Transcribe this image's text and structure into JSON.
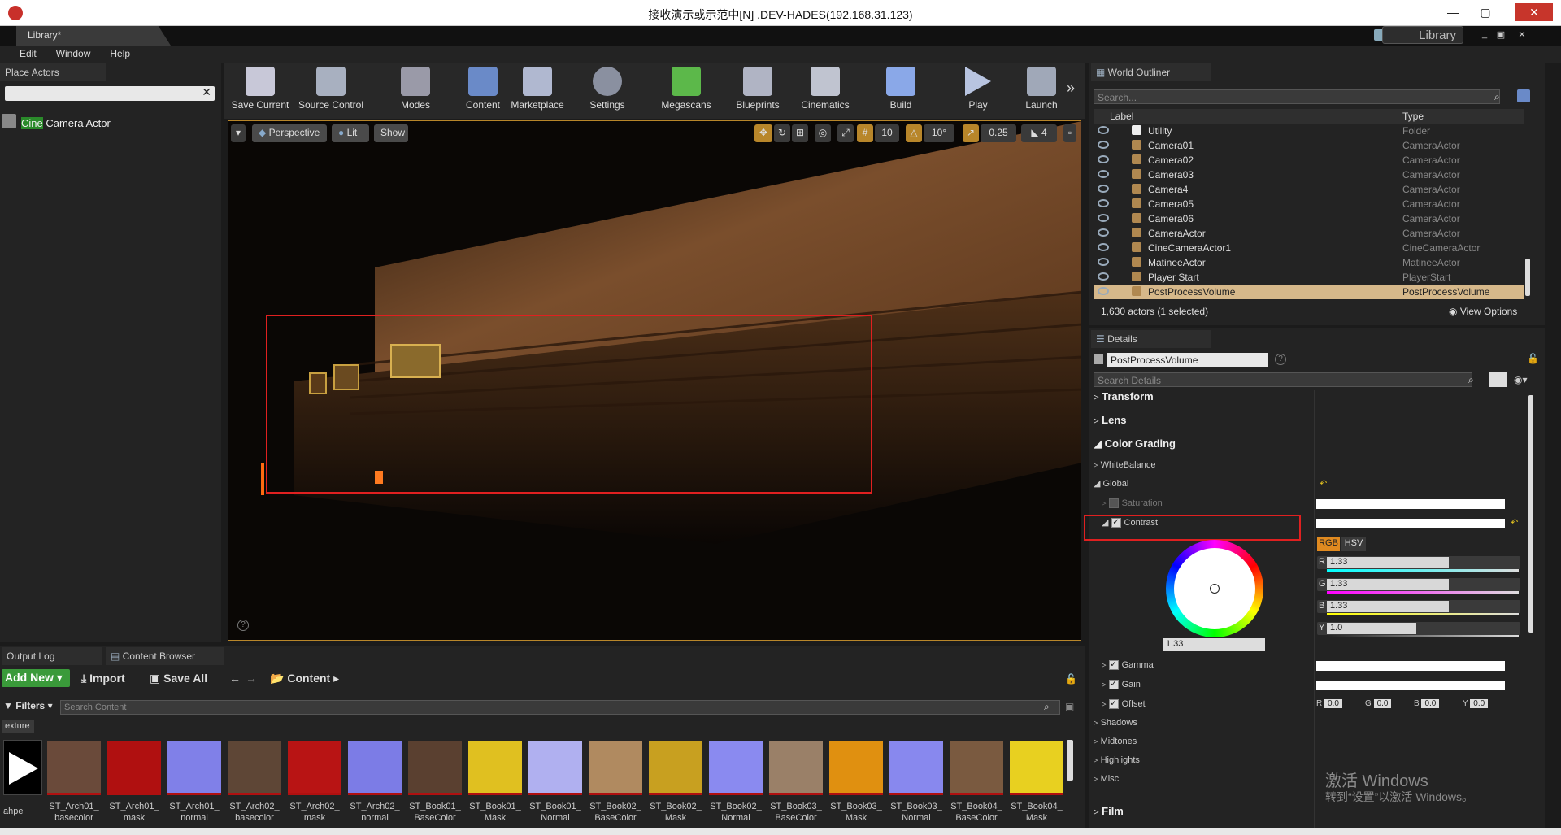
{
  "window": {
    "title": "接收演示或示范中[N] .DEV-HADES(192.168.31.123)"
  },
  "doc_tab": "Library*",
  "library_tag": "Library",
  "menu": [
    "Edit",
    "Window",
    "Help"
  ],
  "place_actors": {
    "tab": "Place Actors",
    "item_highlight": "Cine",
    "item_rest": " Camera Actor"
  },
  "toolbar": [
    {
      "label": "Save Current",
      "icon": "save-icon"
    },
    {
      "label": "Source Control",
      "icon": "source-control-icon"
    },
    {
      "label": "Modes",
      "icon": "modes-icon"
    },
    {
      "label": "Content",
      "icon": "content-icon"
    },
    {
      "label": "Marketplace",
      "icon": "marketplace-icon"
    },
    {
      "label": "Settings",
      "icon": "settings-icon"
    },
    {
      "label": "Megascans",
      "icon": "megascans-icon"
    },
    {
      "label": "Blueprints",
      "icon": "blueprints-icon"
    },
    {
      "label": "Cinematics",
      "icon": "cinematics-icon"
    },
    {
      "label": "Build",
      "icon": "build-icon"
    },
    {
      "label": "Play",
      "icon": "play-icon"
    },
    {
      "label": "Launch",
      "icon": "launch-icon"
    }
  ],
  "viewport": {
    "perspective": "Perspective",
    "lit": "Lit",
    "show": "Show",
    "grid_snap": "10",
    "rot_snap": "10°",
    "scale_snap": "0.25",
    "cam_speed": "4"
  },
  "outliner": {
    "tab": "World Outliner",
    "search_placeholder": "Search...",
    "col_label": "Label",
    "col_type": "Type",
    "rows": [
      {
        "label": "Utility",
        "type": "Folder"
      },
      {
        "label": "Camera01",
        "type": "CameraActor"
      },
      {
        "label": "Camera02",
        "type": "CameraActor"
      },
      {
        "label": "Camera03",
        "type": "CameraActor"
      },
      {
        "label": "Camera4",
        "type": "CameraActor"
      },
      {
        "label": "Camera05",
        "type": "CameraActor"
      },
      {
        "label": "Camera06",
        "type": "CameraActor"
      },
      {
        "label": "CameraActor",
        "type": "CameraActor"
      },
      {
        "label": "CineCameraActor1",
        "type": "CineCameraActor"
      },
      {
        "label": "MatineeActor",
        "type": "MatineeActor"
      },
      {
        "label": "Player Start",
        "type": "PlayerStart"
      },
      {
        "label": "PostProcessVolume",
        "type": "PostProcessVolume"
      }
    ],
    "status": "1,630 actors (1 selected)",
    "view_options": "View Options"
  },
  "details": {
    "tab": "Details",
    "object_name": "PostProcessVolume",
    "search_placeholder": "Search Details",
    "transform": "Transform",
    "lens": "Lens",
    "color_grading": "Color Grading",
    "white_balance": "WhiteBalance",
    "global": "Global",
    "saturation": "Saturation",
    "contrast": "Contrast",
    "rgb": "RGB",
    "hsv": "HSV",
    "r_val": "1.33",
    "g_val": "1.33",
    "b_val": "1.33",
    "y_val": "1.0",
    "wheel_val": "1.33",
    "gamma": "Gamma",
    "gain": "Gain",
    "offset": "Offset",
    "offset_r": "0.0",
    "offset_g": "0.0",
    "offset_b": "0.0",
    "offset_y": "0.0",
    "shadows": "Shadows",
    "midtones": "Midtones",
    "highlights": "Highlights",
    "misc": "Misc",
    "film": "Film"
  },
  "bottom": {
    "output_log": "Output Log",
    "content_browser": "Content Browser",
    "add_new": "Add New",
    "import": "Import",
    "save_all": "Save All",
    "content": "Content",
    "filters": "Filters",
    "search_placeholder": "Search Content",
    "filter_chip": "exture",
    "first_caption": "ahpe",
    "assets": [
      {
        "l1": "ST_Arch01_",
        "l2": "basecolor",
        "c": "#6a4a3a"
      },
      {
        "l1": "ST_Arch01_",
        "l2": "mask",
        "c": "#b01010"
      },
      {
        "l1": "ST_Arch01_",
        "l2": "normal",
        "c": "#8080e8"
      },
      {
        "l1": "ST_Arch02_",
        "l2": "basecolor",
        "c": "#5e4636"
      },
      {
        "l1": "ST_Arch02_",
        "l2": "mask",
        "c": "#b81414"
      },
      {
        "l1": "ST_Arch02_",
        "l2": "normal",
        "c": "#7c7ce6"
      },
      {
        "l1": "ST_Book01_",
        "l2": "BaseColor",
        "c": "#5a4030"
      },
      {
        "l1": "ST_Book01_",
        "l2": "Mask",
        "c": "#e0c020"
      },
      {
        "l1": "ST_Book01_",
        "l2": "Normal",
        "c": "#b0b0f0"
      },
      {
        "l1": "ST_Book02_",
        "l2": "BaseColor",
        "c": "#b08a60"
      },
      {
        "l1": "ST_Book02_",
        "l2": "Mask",
        "c": "#c8a020"
      },
      {
        "l1": "ST_Book02_",
        "l2": "Normal",
        "c": "#8a8af0"
      },
      {
        "l1": "ST_Book03_",
        "l2": "BaseColor",
        "c": "#9a8068"
      },
      {
        "l1": "ST_Book03_",
        "l2": "Mask",
        "c": "#e09010"
      },
      {
        "l1": "ST_Book03_",
        "l2": "Normal",
        "c": "#8888ee"
      },
      {
        "l1": "ST_Book04_",
        "l2": "BaseColor",
        "c": "#7a5a40"
      },
      {
        "l1": "ST_Book04_",
        "l2": "Mask",
        "c": "#e8d020"
      }
    ]
  },
  "watermark": {
    "line1": "激活 Windows",
    "line2": "转到“设置”以激活 Windows。"
  },
  "colors": {
    "accent_orange": "#e08a20",
    "selection": "#d6b88a",
    "annotation_red": "#e02020"
  }
}
